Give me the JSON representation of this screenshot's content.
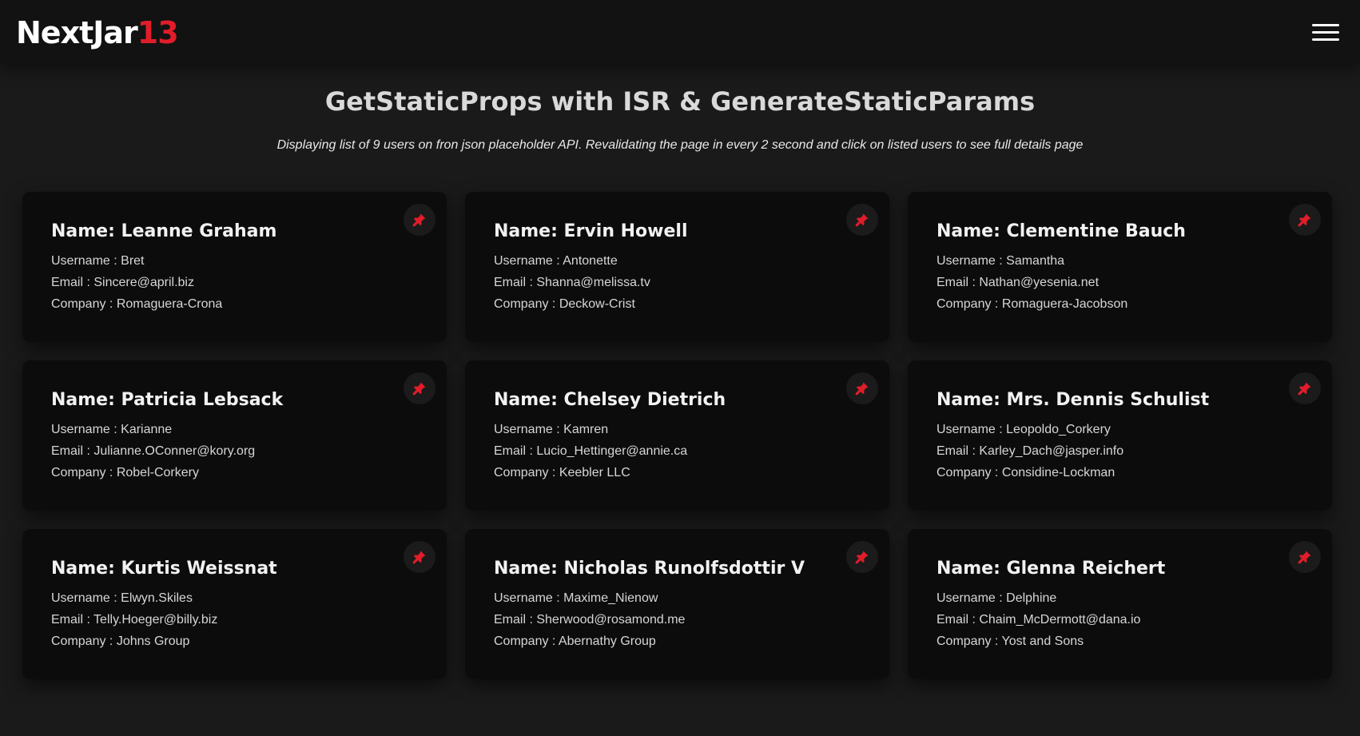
{
  "brand": {
    "name": "NextJar",
    "accent": "13",
    "accent_color": "#e11d2a"
  },
  "menu_icon": "hamburger-icon",
  "header": {
    "title": "GetStaticProps with ISR & GenerateStaticParams",
    "subtitle": "Displaying list of 9 users on fron json placeholder API. Revalidating the page in every 2 second and click on listed users to see full details page"
  },
  "pin_icon": "pushpin-icon",
  "users": [
    {
      "name": "Name: Leanne Graham",
      "username": "Username : Bret",
      "email": "Email : Sincere@april.biz",
      "company": "Company : Romaguera-Crona"
    },
    {
      "name": "Name: Ervin Howell",
      "username": "Username : Antonette",
      "email": "Email : Shanna@melissa.tv",
      "company": "Company : Deckow-Crist"
    },
    {
      "name": "Name: Clementine Bauch",
      "username": "Username : Samantha",
      "email": "Email : Nathan@yesenia.net",
      "company": "Company : Romaguera-Jacobson"
    },
    {
      "name": "Name: Patricia Lebsack",
      "username": "Username : Karianne",
      "email": "Email : Julianne.OConner@kory.org",
      "company": "Company : Robel-Corkery"
    },
    {
      "name": "Name: Chelsey Dietrich",
      "username": "Username : Kamren",
      "email": "Email : Lucio_Hettinger@annie.ca",
      "company": "Company : Keebler LLC"
    },
    {
      "name": "Name: Mrs. Dennis Schulist",
      "username": "Username : Leopoldo_Corkery",
      "email": "Email : Karley_Dach@jasper.info",
      "company": "Company : Considine-Lockman"
    },
    {
      "name": "Name: Kurtis Weissnat",
      "username": "Username : Elwyn.Skiles",
      "email": "Email : Telly.Hoeger@billy.biz",
      "company": "Company : Johns Group"
    },
    {
      "name": "Name: Nicholas Runolfsdottir V",
      "username": "Username : Maxime_Nienow",
      "email": "Email : Sherwood@rosamond.me",
      "company": "Company : Abernathy Group"
    },
    {
      "name": "Name: Glenna Reichert",
      "username": "Username : Delphine",
      "email": "Email : Chaim_McDermott@dana.io",
      "company": "Company : Yost and Sons"
    }
  ]
}
